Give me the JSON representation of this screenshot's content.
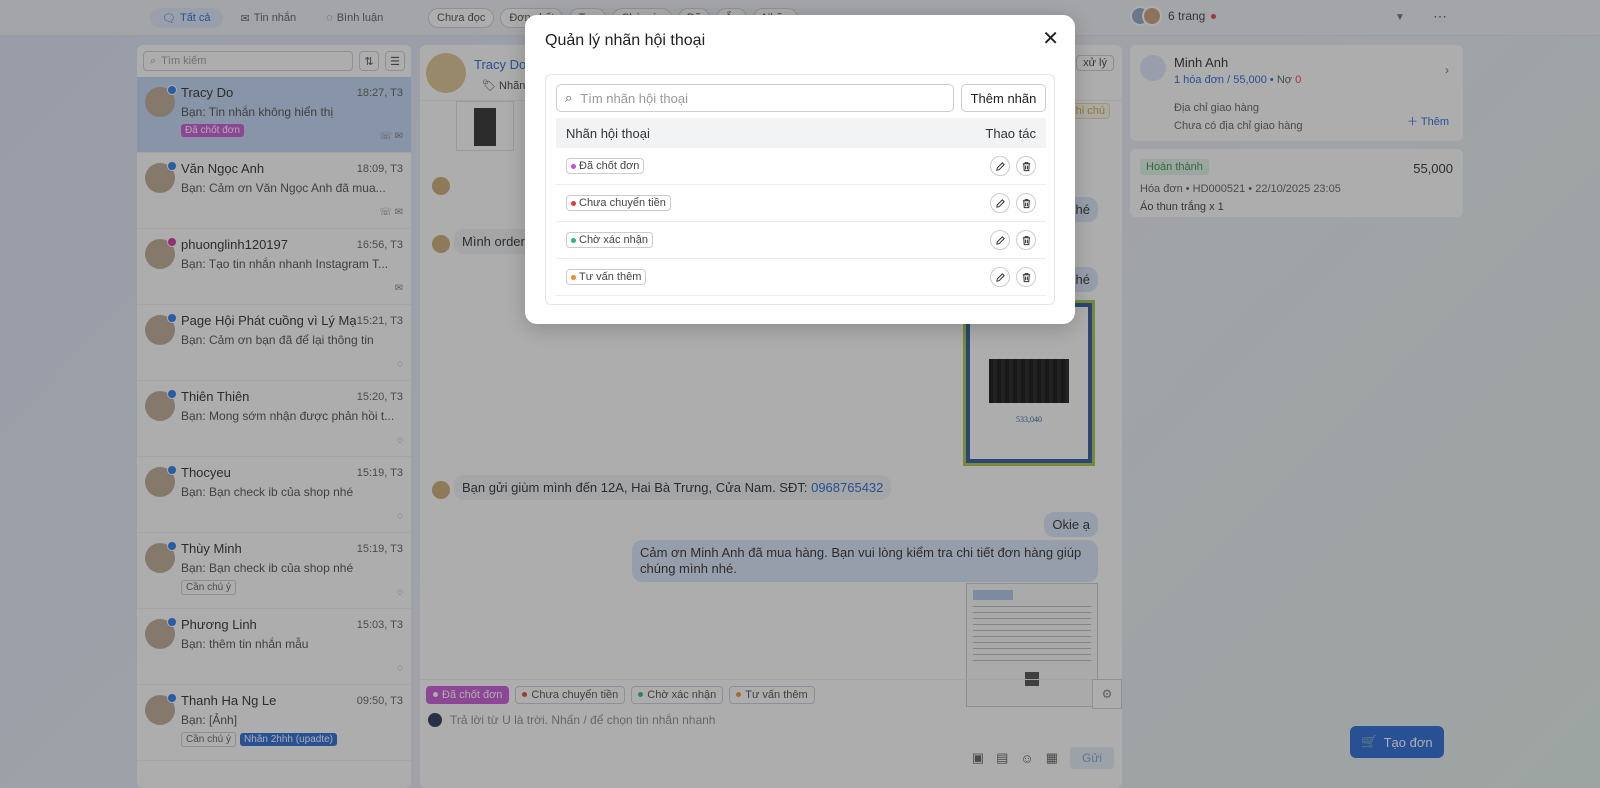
{
  "topbar": {
    "tabs": [
      {
        "label": "Tất cả",
        "icon": "chat-bubbles-icon"
      },
      {
        "label": "Tin nhắn",
        "icon": "mail-icon"
      },
      {
        "label": "Bình luận",
        "icon": "comment-icon"
      }
    ],
    "filters": [
      "Chưa đọc",
      "Đơn chốt",
      "Tạo",
      "Chờ xác",
      "Đã",
      "Ẩn",
      "Nhãn"
    ],
    "pages_label": "6 trang"
  },
  "conversations": {
    "search_placeholder": "Tìm kiếm",
    "items": [
      {
        "name": "Tracy Do",
        "time": "18:27, T3",
        "message": "Bạn: Tin nhắn không hiển thị",
        "tags": [
          "Đã chốt đơn"
        ],
        "platform": "facebook",
        "selected": true,
        "icons": "☏ ✉"
      },
      {
        "name": "Văn Ngọc Anh",
        "time": "18:09, T3",
        "message": "Bạn: Cảm ơn Văn Ngọc Anh đã mua...",
        "tags": [],
        "platform": "facebook",
        "icons": "☏ ✉"
      },
      {
        "name": "phuonglinh120197",
        "time": "16:56, T3",
        "message": "Bạn: Tạo tin nhắn nhanh Instagram T...",
        "tags": [],
        "platform": "instagram",
        "icons": "✉"
      },
      {
        "name": "Page Hội Phát cuồng vì Lý Mạc Sầu",
        "time": "15:21, T3",
        "message": "Bạn: Cảm ơn bạn đã để lại thông tin",
        "tags": [],
        "platform": "facebook",
        "icons": "◌"
      },
      {
        "name": "Thiên Thiên",
        "time": "15:20, T3",
        "message": "Bạn: Mong sớm nhận được phản hồi t...",
        "tags": [],
        "platform": "facebook",
        "icons": "◌"
      },
      {
        "name": "Thocyeu",
        "time": "15:19, T3",
        "message": "Bạn: Bạn check ib của shop nhé",
        "tags": [],
        "platform": "facebook",
        "icons": "◌"
      },
      {
        "name": "Thùy Minh",
        "time": "15:19, T3",
        "message": "Bạn: Bạn check ib của shop nhé",
        "tags": [
          "Cần chú ý"
        ],
        "platform": "facebook",
        "icons": "◌"
      },
      {
        "name": "Phương Linh",
        "time": "15:03, T3",
        "message": "Bạn: thêm tin nhắn mẫu",
        "tags": [],
        "platform": "facebook",
        "icons": "◌"
      },
      {
        "name": "Thanh Ha Ng Le",
        "time": "09:50, T3",
        "message": "Bạn: [Ảnh]",
        "tags": [
          "Cần chú ý",
          "Nhãn 2hhh (upadte)"
        ],
        "platform": "facebook",
        "icons": ""
      }
    ]
  },
  "chat": {
    "contact_name": "Tracy Do",
    "contact_tag_label": "Nhãn",
    "status_label": "xử lý",
    "note_label": "hi chú",
    "messages": {
      "m1": "nhé",
      "m2": "Mình order",
      "m3": "nhé",
      "m4": "Bạn gửi giùm mình đến 12A, Hai Bà Trưng, Cửa Nam. SĐT: ",
      "m4_phone": "0968765432",
      "m5": "Okie ạ",
      "m6": "Cảm ơn Minh Anh đã mua hàng. Bạn vui lòng kiểm tra chi tiết đơn hàng giúp chúng mình nhé."
    },
    "qr_amount": "533,040",
    "tag_bar": [
      {
        "label": "Đã chốt đơn",
        "color": "#c94fd6",
        "active": true
      },
      {
        "label": "Chưa chuyển tiền",
        "color": "#e33b3b",
        "active": false
      },
      {
        "label": "Chờ xác nhận",
        "color": "#2bb673",
        "active": false
      },
      {
        "label": "Tư vấn thêm",
        "color": "#f28b20",
        "active": false
      }
    ],
    "reply_placeholder": "Trả lời từ U là trời. Nhấn / để chọn tin nhắn nhanh",
    "send_label": "Gửi"
  },
  "customer": {
    "name": "Minh Anh",
    "invoice_count": "1 hóa đơn",
    "total": "55,000",
    "debt_label": "Nợ",
    "debt": "0",
    "address_label": "Địa chỉ giao hàng",
    "address_empty": "Chưa có địa chỉ giao hàng",
    "add_label": "Thêm"
  },
  "order": {
    "status": "Hoàn thành",
    "amount": "55,000",
    "meta": "Hóa đơn • HD000521 • 22/10/2025 23:05",
    "item": "Áo thun trắng x 1"
  },
  "create_order_label": "Tạo đơn",
  "modal": {
    "title": "Quản lý nhãn hội thoại",
    "search_placeholder": "Tìm nhãn hội thoại",
    "add_button": "Thêm nhãn",
    "col_label": "Nhãn hội thoại",
    "col_actions": "Thao tác",
    "labels": [
      {
        "name": "Đã chốt đơn",
        "color": "#c94fd6"
      },
      {
        "name": "Chưa chuyển tiền",
        "color": "#e33b3b"
      },
      {
        "name": "Chờ xác nhận",
        "color": "#2bb673"
      },
      {
        "name": "Tư vấn thêm",
        "color": "#f28b20"
      }
    ]
  }
}
